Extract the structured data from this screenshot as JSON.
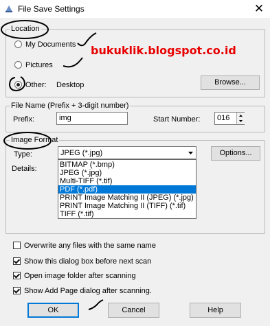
{
  "window": {
    "title": "File Save Settings",
    "close_glyph": "✕"
  },
  "location": {
    "legend": "Location",
    "options": [
      {
        "label": "My Documents",
        "checked": false
      },
      {
        "label": "Pictures",
        "checked": false
      },
      {
        "label": "Other:",
        "checked": true
      }
    ],
    "other_value": "Desktop",
    "browse_label": "Browse..."
  },
  "watermark": "bukuklik.blogspot.co.id",
  "file_name": {
    "legend": "File Name (Prefix + 3-digit number)",
    "prefix_label": "Prefix:",
    "prefix_value": "img",
    "start_label": "Start Number:",
    "start_value": "016"
  },
  "image_format": {
    "legend": "Image Format",
    "type_label": "Type:",
    "selected": "JPEG (*.jpg)",
    "options_label": "Options...",
    "details_label": "Details:",
    "dropdown_items": [
      "BITMAP (*.bmp)",
      "JPEG (*.jpg)",
      "Multi-TIFF (*.tif)",
      "PDF (*.pdf)",
      "PRINT Image Matching II (JPEG) (*.jpg)",
      "PRINT Image Matching II (TIFF) (*.tif)",
      "TIFF (*.tif)"
    ],
    "highlighted_index": 3
  },
  "checkboxes": [
    {
      "label": "Overwrite any files with the same name",
      "checked": false
    },
    {
      "label": "Show this dialog box before next scan",
      "checked": true
    },
    {
      "label": "Open image folder after scanning",
      "checked": true
    },
    {
      "label": "Show Add Page dialog after scanning.",
      "checked": true
    }
  ],
  "buttons": {
    "ok": "OK",
    "cancel": "Cancel",
    "help": "Help"
  },
  "colors": {
    "accent": "#0078d7",
    "watermark": "#e80000",
    "annotation": "#000000"
  }
}
